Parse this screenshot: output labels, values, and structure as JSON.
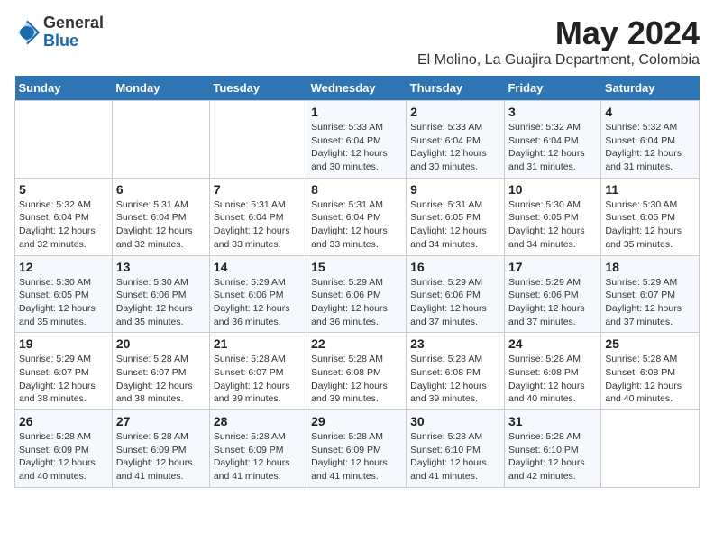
{
  "logo": {
    "general": "General",
    "blue": "Blue"
  },
  "title": "May 2024",
  "location": "El Molino, La Guajira Department, Colombia",
  "days_of_week": [
    "Sunday",
    "Monday",
    "Tuesday",
    "Wednesday",
    "Thursday",
    "Friday",
    "Saturday"
  ],
  "weeks": [
    [
      {
        "day": "",
        "info": ""
      },
      {
        "day": "",
        "info": ""
      },
      {
        "day": "",
        "info": ""
      },
      {
        "day": "1",
        "info": "Sunrise: 5:33 AM\nSunset: 6:04 PM\nDaylight: 12 hours\nand 30 minutes."
      },
      {
        "day": "2",
        "info": "Sunrise: 5:33 AM\nSunset: 6:04 PM\nDaylight: 12 hours\nand 30 minutes."
      },
      {
        "day": "3",
        "info": "Sunrise: 5:32 AM\nSunset: 6:04 PM\nDaylight: 12 hours\nand 31 minutes."
      },
      {
        "day": "4",
        "info": "Sunrise: 5:32 AM\nSunset: 6:04 PM\nDaylight: 12 hours\nand 31 minutes."
      }
    ],
    [
      {
        "day": "5",
        "info": "Sunrise: 5:32 AM\nSunset: 6:04 PM\nDaylight: 12 hours\nand 32 minutes."
      },
      {
        "day": "6",
        "info": "Sunrise: 5:31 AM\nSunset: 6:04 PM\nDaylight: 12 hours\nand 32 minutes."
      },
      {
        "day": "7",
        "info": "Sunrise: 5:31 AM\nSunset: 6:04 PM\nDaylight: 12 hours\nand 33 minutes."
      },
      {
        "day": "8",
        "info": "Sunrise: 5:31 AM\nSunset: 6:04 PM\nDaylight: 12 hours\nand 33 minutes."
      },
      {
        "day": "9",
        "info": "Sunrise: 5:31 AM\nSunset: 6:05 PM\nDaylight: 12 hours\nand 34 minutes."
      },
      {
        "day": "10",
        "info": "Sunrise: 5:30 AM\nSunset: 6:05 PM\nDaylight: 12 hours\nand 34 minutes."
      },
      {
        "day": "11",
        "info": "Sunrise: 5:30 AM\nSunset: 6:05 PM\nDaylight: 12 hours\nand 35 minutes."
      }
    ],
    [
      {
        "day": "12",
        "info": "Sunrise: 5:30 AM\nSunset: 6:05 PM\nDaylight: 12 hours\nand 35 minutes."
      },
      {
        "day": "13",
        "info": "Sunrise: 5:30 AM\nSunset: 6:06 PM\nDaylight: 12 hours\nand 35 minutes."
      },
      {
        "day": "14",
        "info": "Sunrise: 5:29 AM\nSunset: 6:06 PM\nDaylight: 12 hours\nand 36 minutes."
      },
      {
        "day": "15",
        "info": "Sunrise: 5:29 AM\nSunset: 6:06 PM\nDaylight: 12 hours\nand 36 minutes."
      },
      {
        "day": "16",
        "info": "Sunrise: 5:29 AM\nSunset: 6:06 PM\nDaylight: 12 hours\nand 37 minutes."
      },
      {
        "day": "17",
        "info": "Sunrise: 5:29 AM\nSunset: 6:06 PM\nDaylight: 12 hours\nand 37 minutes."
      },
      {
        "day": "18",
        "info": "Sunrise: 5:29 AM\nSunset: 6:07 PM\nDaylight: 12 hours\nand 37 minutes."
      }
    ],
    [
      {
        "day": "19",
        "info": "Sunrise: 5:29 AM\nSunset: 6:07 PM\nDaylight: 12 hours\nand 38 minutes."
      },
      {
        "day": "20",
        "info": "Sunrise: 5:28 AM\nSunset: 6:07 PM\nDaylight: 12 hours\nand 38 minutes."
      },
      {
        "day": "21",
        "info": "Sunrise: 5:28 AM\nSunset: 6:07 PM\nDaylight: 12 hours\nand 39 minutes."
      },
      {
        "day": "22",
        "info": "Sunrise: 5:28 AM\nSunset: 6:08 PM\nDaylight: 12 hours\nand 39 minutes."
      },
      {
        "day": "23",
        "info": "Sunrise: 5:28 AM\nSunset: 6:08 PM\nDaylight: 12 hours\nand 39 minutes."
      },
      {
        "day": "24",
        "info": "Sunrise: 5:28 AM\nSunset: 6:08 PM\nDaylight: 12 hours\nand 40 minutes."
      },
      {
        "day": "25",
        "info": "Sunrise: 5:28 AM\nSunset: 6:08 PM\nDaylight: 12 hours\nand 40 minutes."
      }
    ],
    [
      {
        "day": "26",
        "info": "Sunrise: 5:28 AM\nSunset: 6:09 PM\nDaylight: 12 hours\nand 40 minutes."
      },
      {
        "day": "27",
        "info": "Sunrise: 5:28 AM\nSunset: 6:09 PM\nDaylight: 12 hours\nand 41 minutes."
      },
      {
        "day": "28",
        "info": "Sunrise: 5:28 AM\nSunset: 6:09 PM\nDaylight: 12 hours\nand 41 minutes."
      },
      {
        "day": "29",
        "info": "Sunrise: 5:28 AM\nSunset: 6:09 PM\nDaylight: 12 hours\nand 41 minutes."
      },
      {
        "day": "30",
        "info": "Sunrise: 5:28 AM\nSunset: 6:10 PM\nDaylight: 12 hours\nand 41 minutes."
      },
      {
        "day": "31",
        "info": "Sunrise: 5:28 AM\nSunset: 6:10 PM\nDaylight: 12 hours\nand 42 minutes."
      },
      {
        "day": "",
        "info": ""
      }
    ]
  ]
}
